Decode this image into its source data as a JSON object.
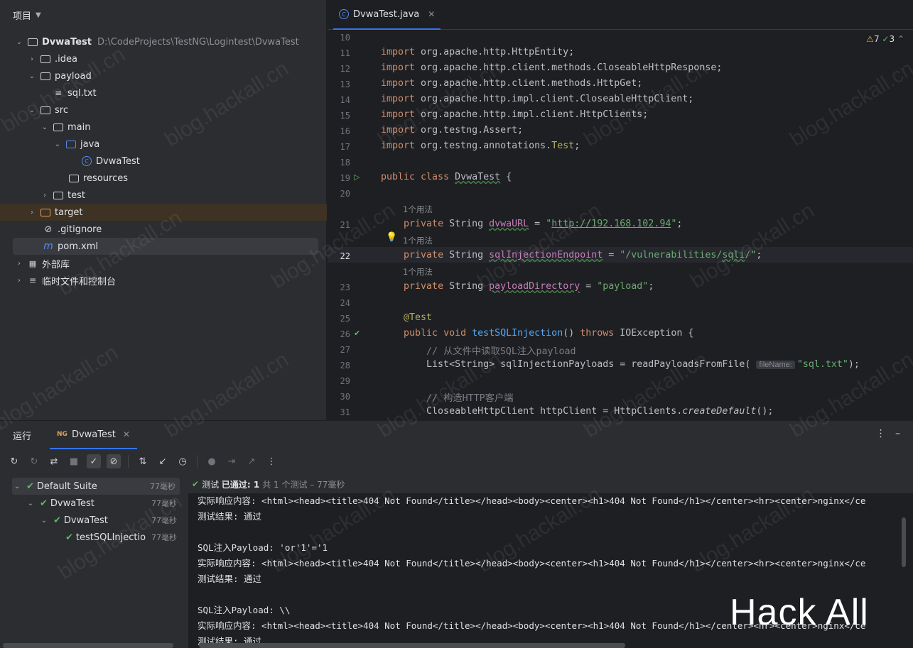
{
  "project": {
    "title": "项目",
    "tree": [
      {
        "label": "DvwaTest",
        "path": "D:\\CodeProjects\\TestNG\\Logintest\\DvwaTest"
      },
      {
        "label": ".idea"
      },
      {
        "label": "payload"
      },
      {
        "label": "sql.txt"
      },
      {
        "label": "src"
      },
      {
        "label": "main"
      },
      {
        "label": "java"
      },
      {
        "label": "DvwaTest"
      },
      {
        "label": "resources"
      },
      {
        "label": "test"
      },
      {
        "label": "target"
      },
      {
        "label": ".gitignore"
      },
      {
        "label": "pom.xml"
      },
      {
        "label": "外部库"
      },
      {
        "label": "临时文件和控制台"
      }
    ]
  },
  "editor": {
    "tab_label": "DvwaTest.java",
    "inspections": {
      "warnings": "7",
      "ok": "3"
    },
    "usage_hint": "1个用法",
    "param_hint": "fileName:",
    "line_numbers": [
      "10",
      "11",
      "12",
      "13",
      "14",
      "15",
      "16",
      "17",
      "18",
      "19",
      "20",
      "21",
      "22",
      "23",
      "24",
      "25",
      "26",
      "27",
      "28",
      "29",
      "30",
      "31"
    ]
  },
  "run": {
    "title": "运行",
    "tab_label": "DvwaTest",
    "tests": [
      {
        "label": "Default Suite",
        "time": "77毫秒"
      },
      {
        "label": "DvwaTest",
        "time": "77毫秒"
      },
      {
        "label": "DvwaTest",
        "time": "77毫秒"
      },
      {
        "label": "testSQLInjectio",
        "time": "77毫秒"
      }
    ],
    "status_prefix": "测试",
    "status_passed": "已通过: 1",
    "status_total": "共 1 个测试 – 77毫秒",
    "console": [
      "实际响应内容: <html><head><title>404 Not Found</title></head><body><center><h1>404 Not Found</h1></center><hr><center>nginx</ce",
      "测试结果: 通过",
      "",
      "SQL注入Payload: 'or'1'='1",
      "实际响应内容: <html><head><title>404 Not Found</title></head><body><center><h1>404 Not Found</h1></center><hr><center>nginx</ce",
      "测试结果: 通过",
      "",
      "SQL注入Payload: \\\\",
      "实际响应内容: <html><head><title>404 Not Found</title></head><body><center><h1>404 Not Found</h1></center><hr><center>nginx</ce",
      "测试结果: 通过"
    ]
  },
  "watermark": {
    "site": "blog.hackall.cn",
    "brand": "Hack All"
  }
}
